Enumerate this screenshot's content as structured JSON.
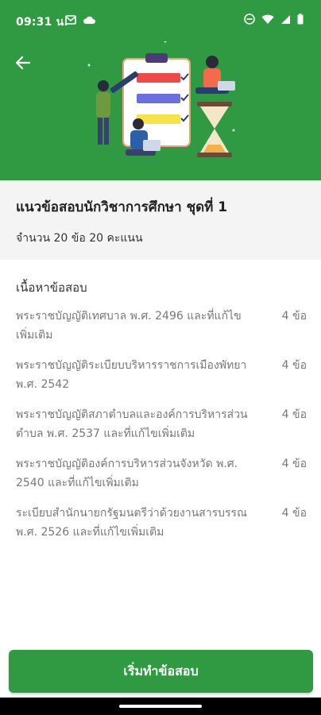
{
  "status_bar": {
    "time": "09:31 น.",
    "icons": [
      "mail-icon",
      "cloud-icon",
      "dnd-icon",
      "wifi-icon",
      "signal-icon",
      "battery-icon"
    ]
  },
  "header": {
    "back_icon": "arrow-left-icon",
    "illustration": "exam-checklist-illustration"
  },
  "exam": {
    "title": "แนวข้อสอบนักวิชาการศึกษา ชุดที่ 1",
    "summary": "จำนวน 20 ข้อ 20 คะแนน"
  },
  "content": {
    "section_title": "เนื้อหาข้อสอบ",
    "items": [
      {
        "label": "พระราชบัญญัติเทศบาล พ.ศ. 2496 และที่แก้ไขเพิ่มเติม",
        "count": "4 ข้อ"
      },
      {
        "label": "พระราชบัญญัติระเบียบบริหารราชการเมืองพัทยา พ.ศ. 2542",
        "count": "4 ข้อ"
      },
      {
        "label": "พระราชบัญญัติสภาตำบลและองค์การบริหารส่วนตำบล พ.ศ. 2537 และที่แก้ไขเพิ่มเติม",
        "count": "4 ข้อ"
      },
      {
        "label": "พระราชบัญญัติองค์การบริหารส่วนจังหวัด พ.ศ. 2540 และที่แก้ไขเพิ่มเติม",
        "count": "4 ข้อ"
      },
      {
        "label": "ระเบียบสำนักนายกรัฐมนตรีว่าด้วยงานสารบรรณ พ.ศ. 2526 และที่แก้ไขเพิ่มเติม",
        "count": "4 ข้อ"
      }
    ]
  },
  "actions": {
    "start_label": "เริ่มทำข้อสอบ"
  },
  "colors": {
    "primary": "#2f9a42",
    "panel": "#f4f4f4"
  }
}
